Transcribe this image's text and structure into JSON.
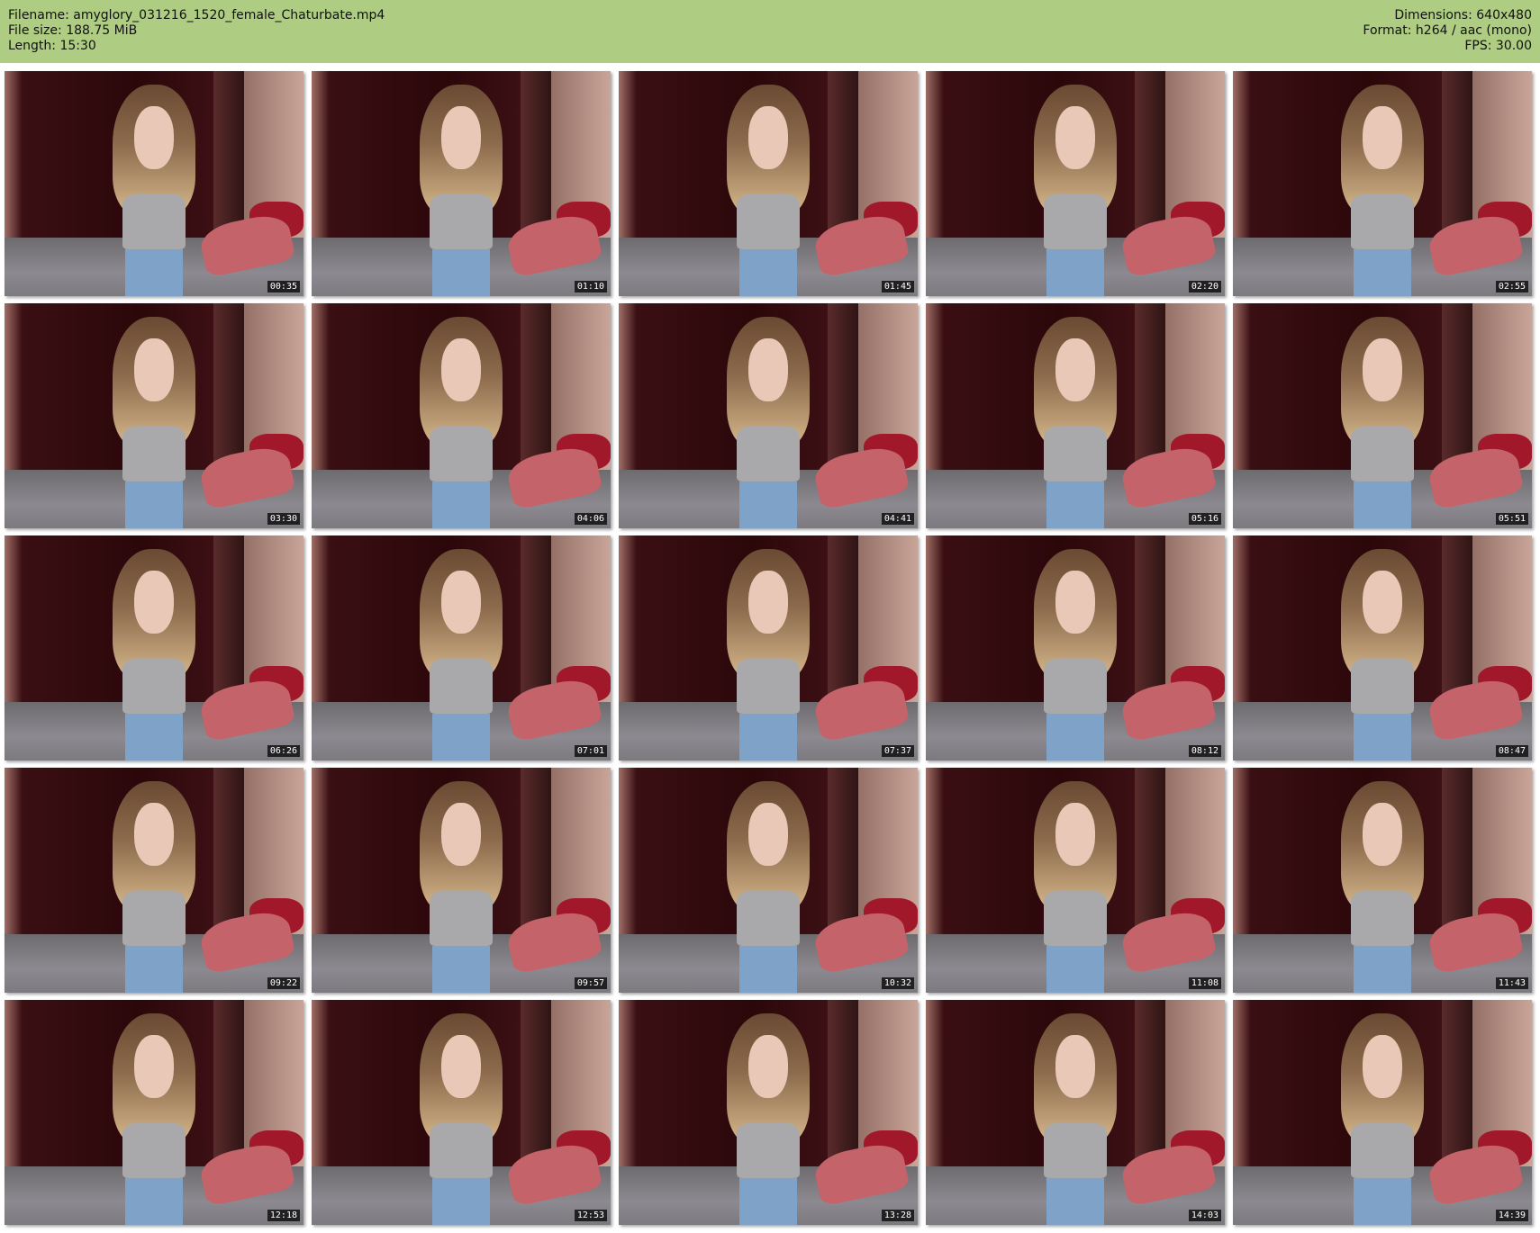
{
  "header": {
    "filename": "Filename: amyglory_031216_1520_female_Chaturbate.mp4",
    "filesize": "File size: 188.75 MiB",
    "length": "Length: 15:30",
    "dimensions": "Dimensions: 640x480",
    "format": "Format: h264 / aac (mono)",
    "fps": "FPS: 30.00"
  },
  "thumbnails": [
    {
      "timestamp": "00:35"
    },
    {
      "timestamp": "01:10"
    },
    {
      "timestamp": "01:45"
    },
    {
      "timestamp": "02:20"
    },
    {
      "timestamp": "02:55"
    },
    {
      "timestamp": "03:30"
    },
    {
      "timestamp": "04:06"
    },
    {
      "timestamp": "04:41"
    },
    {
      "timestamp": "05:16"
    },
    {
      "timestamp": "05:51"
    },
    {
      "timestamp": "06:26"
    },
    {
      "timestamp": "07:01"
    },
    {
      "timestamp": "07:37"
    },
    {
      "timestamp": "08:12"
    },
    {
      "timestamp": "08:47"
    },
    {
      "timestamp": "09:22"
    },
    {
      "timestamp": "09:57"
    },
    {
      "timestamp": "10:32"
    },
    {
      "timestamp": "11:08"
    },
    {
      "timestamp": "11:43"
    },
    {
      "timestamp": "12:18"
    },
    {
      "timestamp": "12:53"
    },
    {
      "timestamp": "13:28"
    },
    {
      "timestamp": "14:03"
    },
    {
      "timestamp": "14:39"
    }
  ],
  "colors": {
    "header_bg": "#aecc82",
    "page_bg": "#ffffff"
  }
}
